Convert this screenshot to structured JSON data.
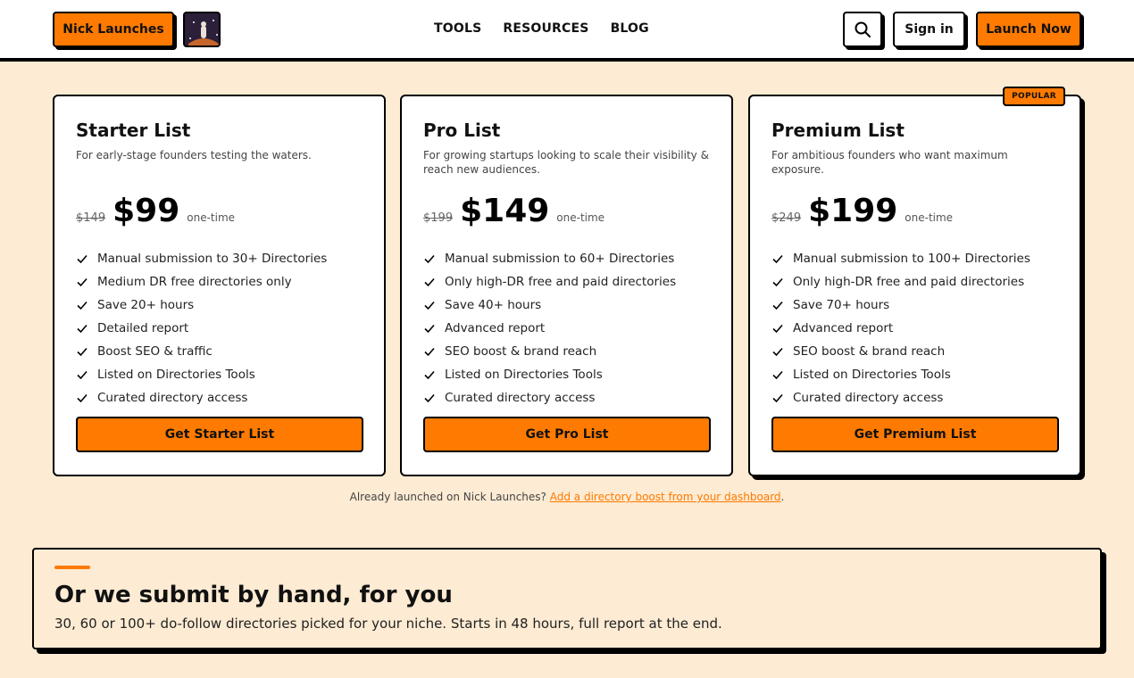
{
  "header": {
    "brand_label": "Nick Launches",
    "nav": [
      "TOOLS",
      "RESOURCES",
      "BLOG"
    ],
    "search_icon": "search-icon",
    "signin_label": "Sign in",
    "launch_label": "Launch Now"
  },
  "plans": [
    {
      "name": "Starter List",
      "desc": "For early-stage founders testing the waters.",
      "old_price": "$149",
      "price": "$99",
      "unit": "one-time",
      "features": [
        "Manual submission to 30+ Directories",
        "Medium DR free directories only",
        "Save 20+ hours",
        "Detailed report",
        "Boost SEO & traffic",
        "Listed on Directories Tools",
        "Curated directory access"
      ],
      "cta": "Get Starter List"
    },
    {
      "name": "Pro List",
      "desc": "For growing startups looking to scale their visibility & reach new audiences.",
      "old_price": "$199",
      "price": "$149",
      "unit": "one-time",
      "features": [
        "Manual submission to 60+ Directories",
        "Only high-DR free and paid directories",
        "Save 40+ hours",
        "Advanced report",
        "SEO boost & brand reach",
        "Listed on Directories Tools",
        "Curated directory access"
      ],
      "cta": "Get Pro List"
    },
    {
      "name": "Premium List",
      "desc": "For ambitious founders who want maximum exposure.",
      "old_price": "$249",
      "price": "$199",
      "unit": "one-time",
      "badge": "POPULAR",
      "features": [
        "Manual submission to 100+ Directories",
        "Only high-DR free and paid directories",
        "Save 70+ hours",
        "Advanced report",
        "SEO boost & brand reach",
        "Listed on Directories Tools",
        "Curated directory access"
      ],
      "cta": "Get Premium List"
    }
  ],
  "note": {
    "text": "Already launched on Nick Launches? ",
    "link": "Add a directory boost from your dashboard",
    "end": "."
  },
  "hand": {
    "title": "Or we submit by hand, for you",
    "subtitle": "30, 60 or 100+ do-follow directories picked for your niche. Starts in 48 hours, full report at the end."
  },
  "colors": {
    "accent": "#ff7a00",
    "background": "#fdebd3"
  }
}
